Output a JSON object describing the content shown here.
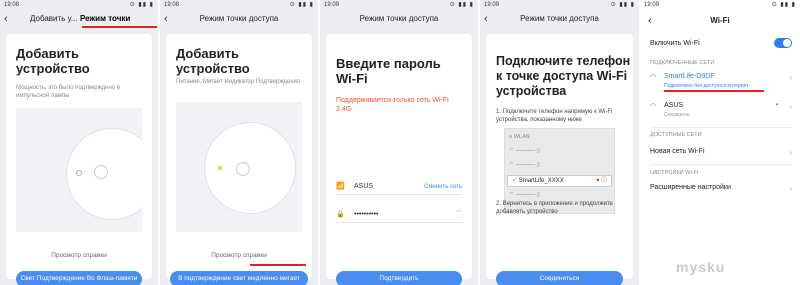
{
  "panels": [
    {
      "status_time": "19:08",
      "header_title": "Добавить у...",
      "header_tab": "Режим точки доступа",
      "heading": "Добавить устройство",
      "description": "Мощность, это было подтверждено в импульсной лампы",
      "help_link": "Просмотр справки",
      "button_label": "Свет Подтверждение Во Флэш-памяти"
    },
    {
      "status_time": "19:08",
      "header_title": "Режим точки доступа",
      "heading": "Добавить устройство",
      "description": "Питание, Мигает Индикатор Подтверждения",
      "help_link": "Просмотр справки",
      "button_label": "В подтверждение свет медленно мигает"
    },
    {
      "status_time": "19:09",
      "header_title": "Режим точки доступа",
      "heading": "Введите пароль Wi-Fi",
      "warning": "Поддерживается только сеть Wi-Fi 2.4G",
      "wifi_name": "ASUS",
      "change_network": "Сменить сеть",
      "password": "••••••••••",
      "button_label": "Подтвердить"
    },
    {
      "status_time": "19:09",
      "header_title": "Режим точки доступа",
      "heading": "Подключите телефон к точке доступа Wi-Fi устройства",
      "step1": "1. Подключите телефон напрямую к Wi-Fi устройства, показанному ниже",
      "ssid": "SmartLife_XXXX",
      "step2": "2. Вернитесь в приложение и продолжите добавлять устройство",
      "button_label": "Соединиться"
    }
  ],
  "settings": {
    "status_time": "19:09",
    "title": "Wi-Fi",
    "enable_label": "Включить Wi-Fi",
    "connected_section": "ПОДКЛЮЧЕННЫЕ СЕТИ",
    "connected_name": "SmartLife-D9DF",
    "connected_status": "Подключено без доступа в интернет",
    "other_name": "ASUS",
    "other_status": "Сохранено",
    "available_section": "ДОСТУПНЫЕ СЕТИ",
    "new_network": "Новая сеть Wi-Fi",
    "settings_section": "НАСТРОЙКИ WI-FI",
    "advanced": "Расширенные настройки"
  },
  "watermark": "mysku"
}
